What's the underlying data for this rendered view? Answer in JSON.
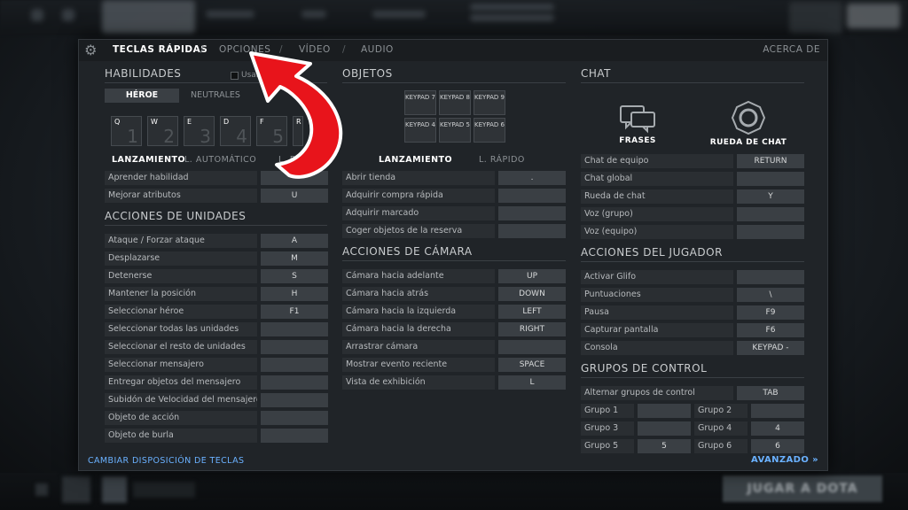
{
  "nav": {
    "tabs": [
      "TECLAS RÁPIDAS",
      "OPCIONES",
      "VÍDEO",
      "AUDIO"
    ],
    "active": 0,
    "about": "ACERCA DE"
  },
  "left": {
    "abilities_title": "HABILIDADES",
    "use_checkbox_label": "Usar t",
    "hero_tabs": [
      "HÉROE",
      "NEUTRALES"
    ],
    "ability_keys": [
      "Q",
      "W",
      "E",
      "D",
      "F",
      "R"
    ],
    "ability_nums": [
      "1",
      "2",
      "3",
      "4",
      "5"
    ],
    "cast_tabs": [
      "LANZAMIENTO",
      "L. AUTOMÁTICO",
      "L. R"
    ],
    "ability_rows": [
      {
        "label": "Aprender habilidad",
        "key": ""
      },
      {
        "label": "Mejorar atributos",
        "key": "U"
      }
    ],
    "units_title": "ACCIONES DE UNIDADES",
    "unit_rows": [
      {
        "label": "Ataque / Forzar ataque",
        "key": "A"
      },
      {
        "label": "Desplazarse",
        "key": "M"
      },
      {
        "label": "Detenerse",
        "key": "S"
      },
      {
        "label": "Mantener la posición",
        "key": "H"
      },
      {
        "label": "Seleccionar héroe",
        "key": "F1"
      },
      {
        "label": "Seleccionar todas las unidades",
        "key": ""
      },
      {
        "label": "Seleccionar el resto de unidades",
        "key": ""
      },
      {
        "label": "Seleccionar mensajero",
        "key": ""
      },
      {
        "label": "Entregar objetos del mensajero",
        "key": ""
      },
      {
        "label": "Subidón de Velocidad del mensajero",
        "key": ""
      },
      {
        "label": "Objeto de acción",
        "key": ""
      },
      {
        "label": "Objeto de burla",
        "key": ""
      }
    ],
    "footer": "CAMBIAR DISPOSICIÓN DE TECLAS"
  },
  "middle": {
    "items_title": "OBJETOS",
    "keypads": [
      "KEYPAD 7",
      "KEYPAD 8",
      "KEYPAD 9",
      "KEYPAD 4",
      "KEYPAD 5",
      "KEYPAD 6"
    ],
    "cast_tabs": [
      "LANZAMIENTO",
      "L. RÁPIDO"
    ],
    "item_rows": [
      {
        "label": "Abrir tienda",
        "key": "."
      },
      {
        "label": "Adquirir compra rápida",
        "key": ""
      },
      {
        "label": "Adquirir marcado",
        "key": ""
      },
      {
        "label": "Coger objetos de la reserva",
        "key": ""
      }
    ],
    "camera_title": "ACCIONES DE CÁMARA",
    "camera_rows": [
      {
        "label": "Cámara hacia adelante",
        "key": "UP"
      },
      {
        "label": "Cámara hacia atrás",
        "key": "DOWN"
      },
      {
        "label": "Cámara hacia la izquierda",
        "key": "LEFT"
      },
      {
        "label": "Cámara hacia la derecha",
        "key": "RIGHT"
      },
      {
        "label": "Arrastrar cámara",
        "key": ""
      },
      {
        "label": "Mostrar evento reciente",
        "key": "SPACE"
      },
      {
        "label": "Vista de exhibición",
        "key": "L"
      }
    ]
  },
  "right": {
    "chat_title": "CHAT",
    "phrases_label": "FRASES",
    "wheel_label": "RUEDA DE CHAT",
    "chat_rows": [
      {
        "label": "Chat de equipo",
        "key": "RETURN"
      },
      {
        "label": "Chat global",
        "key": ""
      },
      {
        "label": "Rueda de chat",
        "key": "Y"
      },
      {
        "label": "Voz (grupo)",
        "key": ""
      },
      {
        "label": "Voz (equipo)",
        "key": ""
      }
    ],
    "player_title": "ACCIONES DEL JUGADOR",
    "player_rows": [
      {
        "label": "Activar Glifo",
        "key": ""
      },
      {
        "label": "Puntuaciones",
        "key": "\\"
      },
      {
        "label": "Pausa",
        "key": "F9"
      },
      {
        "label": "Capturar pantalla",
        "key": "F6"
      },
      {
        "label": "Consola",
        "key": "KEYPAD -"
      }
    ],
    "groups_title": "GRUPOS DE CONTROL",
    "toggle_groups": {
      "label": "Alternar grupos de control",
      "key": "TAB"
    },
    "groups": [
      {
        "label": "Grupo 1",
        "key": ""
      },
      {
        "label": "Grupo 2",
        "key": ""
      },
      {
        "label": "Grupo 3",
        "key": ""
      },
      {
        "label": "Grupo 4",
        "key": "4"
      },
      {
        "label": "Grupo 5",
        "key": "5"
      },
      {
        "label": "Grupo 6",
        "key": "6"
      }
    ],
    "advanced": "AVANZADO »"
  },
  "bottom": {
    "play_button": "JUGAR A DOTA"
  },
  "colors": {
    "accent_link": "#6ab1ff",
    "arrow": "#e8141b",
    "panel": "#202428"
  }
}
